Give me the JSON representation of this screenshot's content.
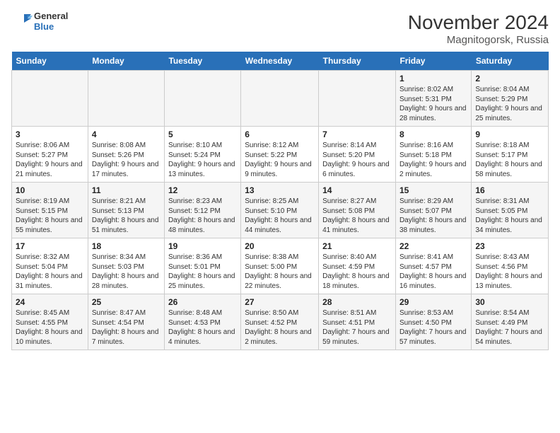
{
  "header": {
    "title": "November 2024",
    "subtitle": "Magnitogorsk, Russia",
    "logo_line1": "General",
    "logo_line2": "Blue"
  },
  "columns": [
    "Sunday",
    "Monday",
    "Tuesday",
    "Wednesday",
    "Thursday",
    "Friday",
    "Saturday"
  ],
  "weeks": [
    [
      {
        "day": "",
        "info": ""
      },
      {
        "day": "",
        "info": ""
      },
      {
        "day": "",
        "info": ""
      },
      {
        "day": "",
        "info": ""
      },
      {
        "day": "",
        "info": ""
      },
      {
        "day": "1",
        "info": "Sunrise: 8:02 AM\nSunset: 5:31 PM\nDaylight: 9 hours and 28 minutes."
      },
      {
        "day": "2",
        "info": "Sunrise: 8:04 AM\nSunset: 5:29 PM\nDaylight: 9 hours and 25 minutes."
      }
    ],
    [
      {
        "day": "3",
        "info": "Sunrise: 8:06 AM\nSunset: 5:27 PM\nDaylight: 9 hours and 21 minutes."
      },
      {
        "day": "4",
        "info": "Sunrise: 8:08 AM\nSunset: 5:26 PM\nDaylight: 9 hours and 17 minutes."
      },
      {
        "day": "5",
        "info": "Sunrise: 8:10 AM\nSunset: 5:24 PM\nDaylight: 9 hours and 13 minutes."
      },
      {
        "day": "6",
        "info": "Sunrise: 8:12 AM\nSunset: 5:22 PM\nDaylight: 9 hours and 9 minutes."
      },
      {
        "day": "7",
        "info": "Sunrise: 8:14 AM\nSunset: 5:20 PM\nDaylight: 9 hours and 6 minutes."
      },
      {
        "day": "8",
        "info": "Sunrise: 8:16 AM\nSunset: 5:18 PM\nDaylight: 9 hours and 2 minutes."
      },
      {
        "day": "9",
        "info": "Sunrise: 8:18 AM\nSunset: 5:17 PM\nDaylight: 8 hours and 58 minutes."
      }
    ],
    [
      {
        "day": "10",
        "info": "Sunrise: 8:19 AM\nSunset: 5:15 PM\nDaylight: 8 hours and 55 minutes."
      },
      {
        "day": "11",
        "info": "Sunrise: 8:21 AM\nSunset: 5:13 PM\nDaylight: 8 hours and 51 minutes."
      },
      {
        "day": "12",
        "info": "Sunrise: 8:23 AM\nSunset: 5:12 PM\nDaylight: 8 hours and 48 minutes."
      },
      {
        "day": "13",
        "info": "Sunrise: 8:25 AM\nSunset: 5:10 PM\nDaylight: 8 hours and 44 minutes."
      },
      {
        "day": "14",
        "info": "Sunrise: 8:27 AM\nSunset: 5:08 PM\nDaylight: 8 hours and 41 minutes."
      },
      {
        "day": "15",
        "info": "Sunrise: 8:29 AM\nSunset: 5:07 PM\nDaylight: 8 hours and 38 minutes."
      },
      {
        "day": "16",
        "info": "Sunrise: 8:31 AM\nSunset: 5:05 PM\nDaylight: 8 hours and 34 minutes."
      }
    ],
    [
      {
        "day": "17",
        "info": "Sunrise: 8:32 AM\nSunset: 5:04 PM\nDaylight: 8 hours and 31 minutes."
      },
      {
        "day": "18",
        "info": "Sunrise: 8:34 AM\nSunset: 5:03 PM\nDaylight: 8 hours and 28 minutes."
      },
      {
        "day": "19",
        "info": "Sunrise: 8:36 AM\nSunset: 5:01 PM\nDaylight: 8 hours and 25 minutes."
      },
      {
        "day": "20",
        "info": "Sunrise: 8:38 AM\nSunset: 5:00 PM\nDaylight: 8 hours and 22 minutes."
      },
      {
        "day": "21",
        "info": "Sunrise: 8:40 AM\nSunset: 4:59 PM\nDaylight: 8 hours and 18 minutes."
      },
      {
        "day": "22",
        "info": "Sunrise: 8:41 AM\nSunset: 4:57 PM\nDaylight: 8 hours and 16 minutes."
      },
      {
        "day": "23",
        "info": "Sunrise: 8:43 AM\nSunset: 4:56 PM\nDaylight: 8 hours and 13 minutes."
      }
    ],
    [
      {
        "day": "24",
        "info": "Sunrise: 8:45 AM\nSunset: 4:55 PM\nDaylight: 8 hours and 10 minutes."
      },
      {
        "day": "25",
        "info": "Sunrise: 8:47 AM\nSunset: 4:54 PM\nDaylight: 8 hours and 7 minutes."
      },
      {
        "day": "26",
        "info": "Sunrise: 8:48 AM\nSunset: 4:53 PM\nDaylight: 8 hours and 4 minutes."
      },
      {
        "day": "27",
        "info": "Sunrise: 8:50 AM\nSunset: 4:52 PM\nDaylight: 8 hours and 2 minutes."
      },
      {
        "day": "28",
        "info": "Sunrise: 8:51 AM\nSunset: 4:51 PM\nDaylight: 7 hours and 59 minutes."
      },
      {
        "day": "29",
        "info": "Sunrise: 8:53 AM\nSunset: 4:50 PM\nDaylight: 7 hours and 57 minutes."
      },
      {
        "day": "30",
        "info": "Sunrise: 8:54 AM\nSunset: 4:49 PM\nDaylight: 7 hours and 54 minutes."
      }
    ]
  ]
}
